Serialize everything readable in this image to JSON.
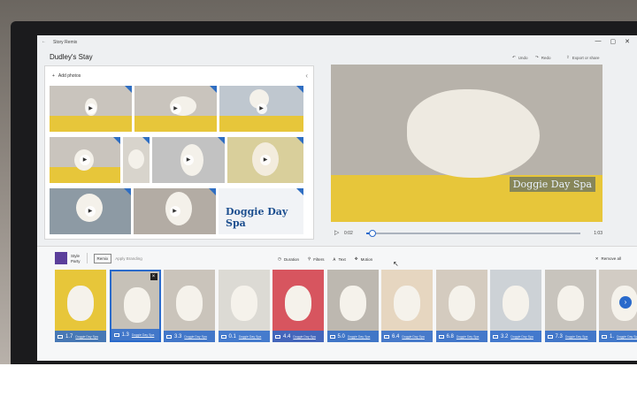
{
  "window": {
    "app_name": "Story Remix",
    "project_title": "Dudley's Stay",
    "controls": [
      "—",
      "▢",
      "✕"
    ]
  },
  "header_actions": {
    "undo": "Undo",
    "redo": "Redo",
    "export": "Export or share"
  },
  "library": {
    "add_photos": "Add photos",
    "thumbs": [
      {
        "has_play": true
      },
      {
        "has_play": true
      },
      {
        "has_play": true
      },
      {
        "has_play": true
      },
      {
        "has_play": false
      },
      {
        "has_play": true
      },
      {
        "has_play": true
      },
      {
        "has_play": true
      },
      {
        "has_play": true
      },
      {
        "has_play": false,
        "text": "Doggie Day Spa"
      }
    ]
  },
  "preview": {
    "overlay_text": "Doggie Day Spa",
    "current_time": "0:02",
    "total_time": "1:03",
    "progress": 0.03
  },
  "storyboard": {
    "theme_label": "Style",
    "theme_name": "Party",
    "remix": "Remix",
    "apply_branding": "Apply Branding",
    "tools": [
      "Duration",
      "Filters",
      "Text",
      "Motion"
    ],
    "remove_all": "Remove all",
    "clips": [
      {
        "duration": "1.7",
        "selected": false
      },
      {
        "duration": "1.3",
        "selected": true
      },
      {
        "duration": "3.3",
        "selected": false
      },
      {
        "duration": "0.1",
        "selected": false
      },
      {
        "duration": "4.4",
        "selected": false
      },
      {
        "duration": "5.0",
        "selected": false
      },
      {
        "duration": "6.4",
        "selected": false
      },
      {
        "duration": "6.8",
        "selected": false
      },
      {
        "duration": "3.2",
        "selected": false
      },
      {
        "duration": "7.3",
        "selected": false
      },
      {
        "duration": "1.",
        "selected": false
      }
    ],
    "clip_sub": "Doggie Day Spa"
  }
}
